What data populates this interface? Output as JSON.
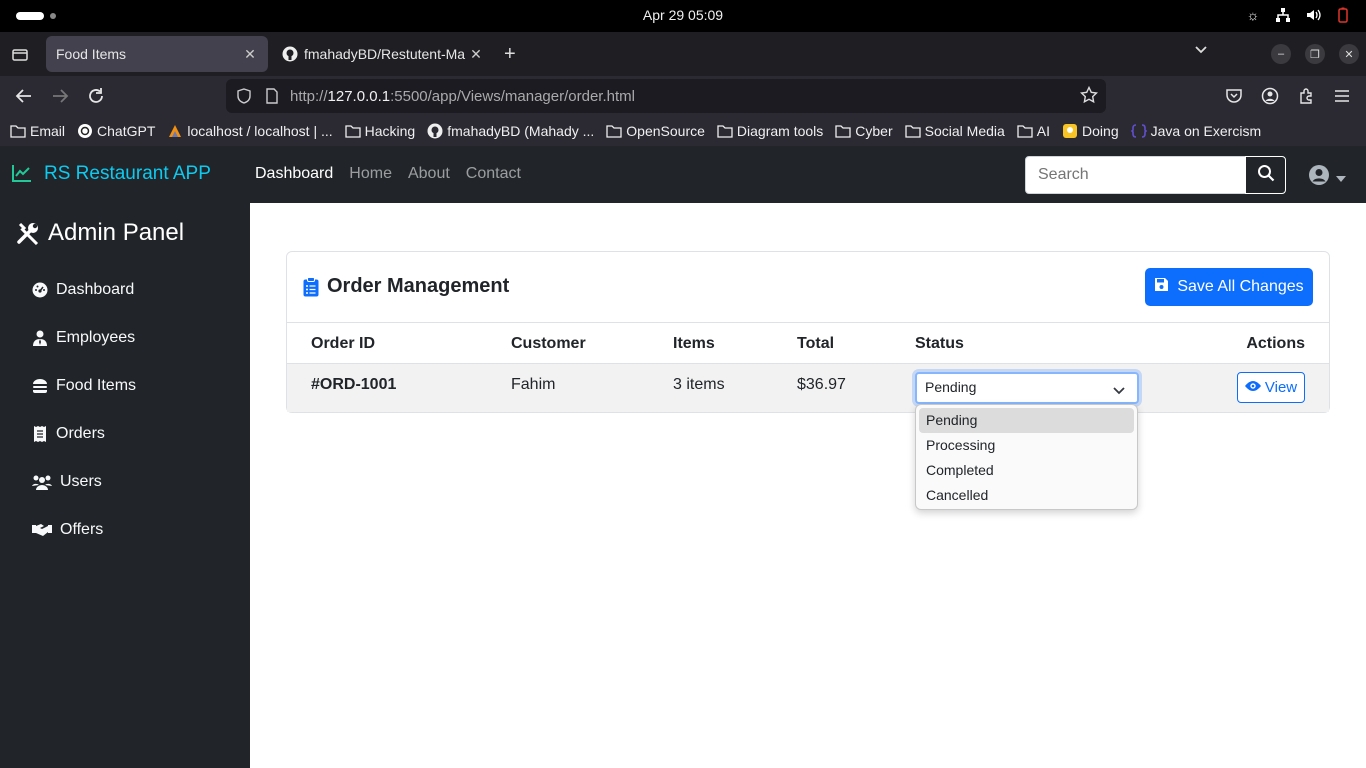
{
  "os": {
    "clock": "Apr 29  05:09"
  },
  "browser": {
    "tabs": [
      {
        "title": "Food Items",
        "active": true
      },
      {
        "title": "fmahadyBD/Restutent-Ma",
        "active": false
      }
    ],
    "url": {
      "prefix": "http://",
      "host": "127.0.0.1",
      "path": ":5500/app/Views/manager/order.html"
    },
    "bookmarks": [
      {
        "label": "Email",
        "icon": "folder-icon"
      },
      {
        "label": "ChatGPT",
        "icon": "chatgpt-icon"
      },
      {
        "label": "localhost / localhost | ...",
        "icon": "phpmyadmin-icon"
      },
      {
        "label": "Hacking",
        "icon": "folder-icon"
      },
      {
        "label": "fmahadyBD (Mahady ...",
        "icon": "github-icon"
      },
      {
        "label": "OpenSource",
        "icon": "folder-icon"
      },
      {
        "label": "Diagram tools",
        "icon": "folder-icon"
      },
      {
        "label": "Cyber",
        "icon": "folder-icon"
      },
      {
        "label": "Social Media",
        "icon": "folder-icon"
      },
      {
        "label": "AI",
        "icon": "folder-icon"
      },
      {
        "label": "Doing",
        "icon": "doing-icon"
      },
      {
        "label": "Java on Exercism",
        "icon": "exercism-icon"
      }
    ]
  },
  "app": {
    "brand": "RS Restaurant APP",
    "nav": [
      "Dashboard",
      "Home",
      "About",
      "Contact"
    ],
    "search_placeholder": "Search"
  },
  "sidebar": {
    "title": "Admin Panel",
    "items": [
      {
        "label": "Dashboard",
        "icon": "gauge-icon"
      },
      {
        "label": "Employees",
        "icon": "user-tie-icon"
      },
      {
        "label": "Food Items",
        "icon": "burger-icon"
      },
      {
        "label": "Orders",
        "icon": "receipt-icon"
      },
      {
        "label": "Users",
        "icon": "users-icon"
      },
      {
        "label": "Offers",
        "icon": "handshake-icon"
      }
    ]
  },
  "orders": {
    "title": "Order Management",
    "save_label": "Save All Changes",
    "columns": [
      "Order ID",
      "Customer",
      "Items",
      "Total",
      "Status",
      "Actions"
    ],
    "rows": [
      {
        "id": "#ORD-1001",
        "customer": "Fahim",
        "items": "3 items",
        "total": "$36.97",
        "status": "Pending",
        "action": "View"
      }
    ],
    "status_options": [
      "Pending",
      "Processing",
      "Completed",
      "Cancelled"
    ]
  },
  "colors": {
    "primary": "#0d6efd",
    "dark": "#212529",
    "brand": "#0dcaf0"
  }
}
